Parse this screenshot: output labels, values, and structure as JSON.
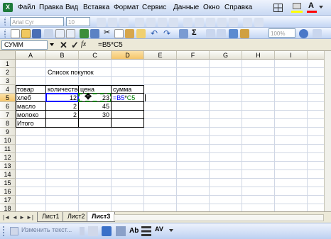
{
  "menu": [
    {
      "key": "file",
      "label": "Файл"
    },
    {
      "key": "edit",
      "label": "Правка"
    },
    {
      "key": "view",
      "label": "Вид"
    },
    {
      "key": "insert",
      "label": "Вставка"
    },
    {
      "key": "format",
      "label": "Формат"
    },
    {
      "key": "tools",
      "label": "Сервис"
    },
    {
      "key": "data",
      "label": "Данные"
    },
    {
      "key": "window",
      "label": "Окно"
    },
    {
      "key": "help",
      "label": "Справка"
    }
  ],
  "toolbar": {
    "font_name": "Arial Cyr",
    "font_size": "10",
    "zoom": "100%"
  },
  "formula_bar": {
    "name_box": "СУММ",
    "formula": "=B5*C5"
  },
  "columns": [
    "A",
    "B",
    "C",
    "D",
    "E",
    "F",
    "G",
    "H",
    "I"
  ],
  "rows": [
    "1",
    "2",
    "3",
    "4",
    "5",
    "6",
    "7",
    "8",
    "9",
    "10",
    "11",
    "12",
    "13",
    "14",
    "15",
    "16",
    "17",
    "18"
  ],
  "cells": {
    "B2": "Список покупок",
    "A4": "товар",
    "B4": "количество",
    "C4": "цена",
    "D4": "сумма",
    "A5": "хлеб",
    "B5": "12",
    "C5": "23",
    "D5_prefix": "=B5",
    "D5_op": "*",
    "D5_ref": "C5",
    "A6": "масло",
    "B6": "2",
    "C6": "45",
    "A7": "молоко",
    "B7": "2",
    "C7": "30",
    "A8": "Итого"
  },
  "sheets": [
    "Лист1",
    "Лист2",
    "Лист3"
  ],
  "active_sheet": "Лист3",
  "drawing_toolbar": {
    "item": "Изменить текст..."
  },
  "colors": {
    "ref_b5": "#0000ff",
    "ref_c5": "#008000"
  }
}
